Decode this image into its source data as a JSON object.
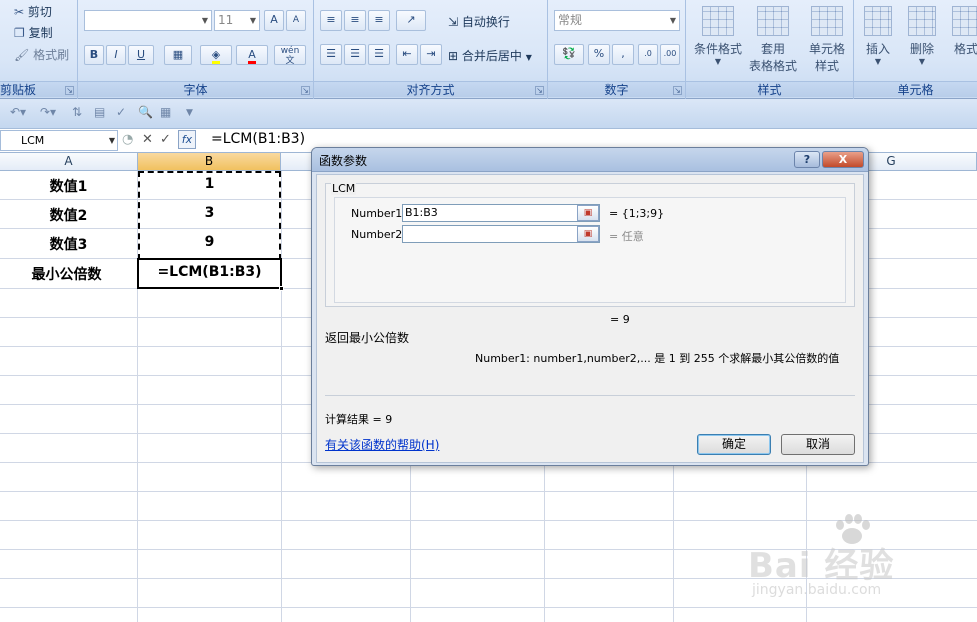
{
  "ribbon": {
    "clipboard": {
      "cut": "剪切",
      "copy": "复制",
      "format_painter": "格式刷",
      "label": "剪贴板"
    },
    "font": {
      "font_name": "",
      "font_size": "11",
      "grow": "A",
      "shrink": "A",
      "bold": "B",
      "italic": "I",
      "underline": "U",
      "wen": "wén",
      "label": "字体"
    },
    "alignment": {
      "wrap_text": "自动换行",
      "merge_center": "合并后居中",
      "label": "对齐方式"
    },
    "number": {
      "format": "常规",
      "percent": "%",
      "comma": ",",
      "label": "数字"
    },
    "styles": {
      "conditional": "条件格式",
      "table_format_1": "套用",
      "table_format_2": "表格格式",
      "cell_style_1": "单元格",
      "cell_style_2": "样式",
      "label": "样式"
    },
    "cells": {
      "insert": "插入",
      "delete": "删除",
      "format": "格式",
      "label": "单元格"
    }
  },
  "formula_bar": {
    "name_box": "LCM",
    "fx": "fx",
    "formula": "=LCM(B1:B3)"
  },
  "grid": {
    "columns": [
      "A",
      "B",
      "G"
    ],
    "rows": [
      {
        "a": "数值1",
        "b": "1"
      },
      {
        "a": "数值2",
        "b": "3"
      },
      {
        "a": "数值3",
        "b": "9"
      },
      {
        "a": "最小公倍数",
        "b": "=LCM(B1:B3)"
      }
    ]
  },
  "dialog": {
    "title": "函数参数",
    "help_btn": "?",
    "close_btn": "X",
    "function_name": "LCM",
    "args": [
      {
        "label": "Number1",
        "value": "B1:B3",
        "result": "= {1;3;9}"
      },
      {
        "label": "Number2",
        "value": "",
        "result": "= 任意"
      }
    ],
    "formula_result": "= 9",
    "description": "返回最小公倍数",
    "arg_help": "Number1:  number1,number2,... 是 1 到 255 个求解最小其公倍数的值",
    "calc_result": "计算结果 = 9",
    "help_link": "有关该函数的帮助(H)",
    "ok": "确定",
    "cancel": "取消"
  },
  "watermark": {
    "brand": "Bai 经验",
    "sub": "jingyan.baidu.com"
  }
}
